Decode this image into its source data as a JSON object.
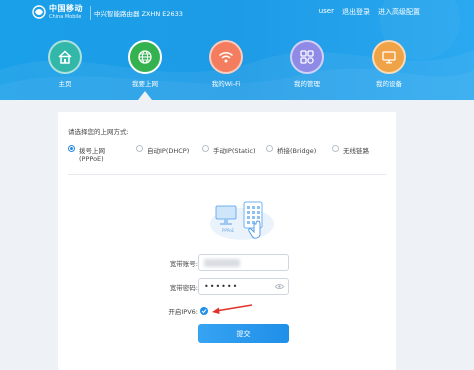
{
  "header": {
    "brand_cn": "中国移动",
    "brand_en": "China Mobile",
    "router_name": "中兴智能路由器 ZXHN E2633",
    "user": "user",
    "logout": "退出登录",
    "advanced": "进入高级配置"
  },
  "nav": {
    "items": [
      {
        "label": "主页",
        "icon": "home-icon",
        "color": "#33b7a9"
      },
      {
        "label": "我要上网",
        "icon": "globe-icon",
        "color": "#33b24f"
      },
      {
        "label": "我的Wi-Fi",
        "icon": "wifi-icon",
        "color": "#f37d5e"
      },
      {
        "label": "我的管理",
        "icon": "grid-icon",
        "color": "#8f8ae6"
      },
      {
        "label": "我的设备",
        "icon": "monitor-icon",
        "color": "#f0a346"
      }
    ],
    "active_index": 1
  },
  "connection": {
    "prompt": "请选择您的上网方式:",
    "options": [
      {
        "label_line1": "拨号上网",
        "label_line2": "(PPPoE)",
        "selected": true
      },
      {
        "label_line1": "自动IP(DHCP)",
        "label_line2": "",
        "selected": false
      },
      {
        "label_line1": "手动IP(Static)",
        "label_line2": "",
        "selected": false
      },
      {
        "label_line1": "桥接(Bridge)",
        "label_line2": "",
        "selected": false
      },
      {
        "label_line1": "无线链路",
        "label_line2": "",
        "selected": false
      }
    ]
  },
  "illustration": {
    "label": "PPPoE"
  },
  "form": {
    "account_label": "宽带账号:",
    "password_label": "宽带密码:",
    "password_value": "••••••",
    "ipv6_label": "开启IPV6:",
    "ipv6_enabled": true,
    "submit_label": "提交"
  },
  "colors": {
    "header_blue": "#1d9be6",
    "accent_blue": "#2a8ae0",
    "arrow_red": "#e0322a"
  }
}
